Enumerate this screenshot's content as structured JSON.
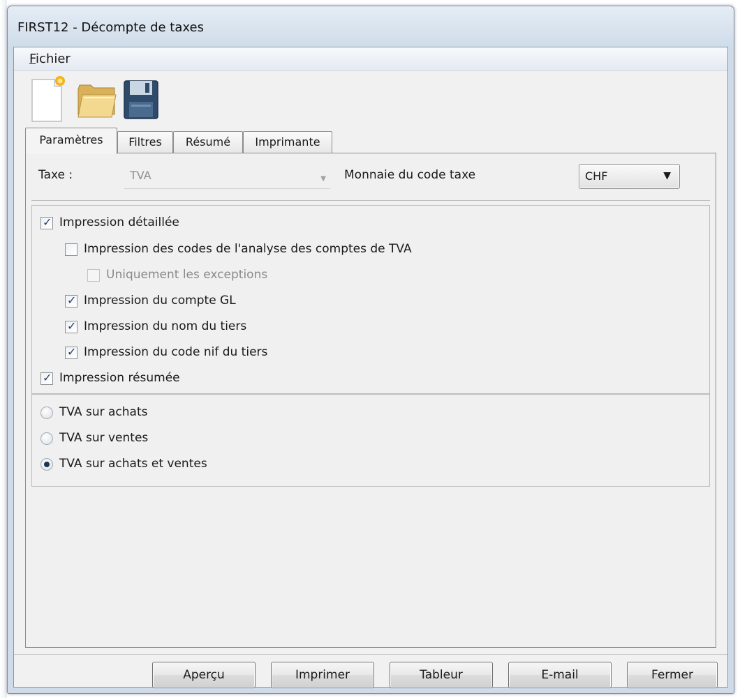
{
  "window": {
    "title": "FIRST12 - Décompte de taxes"
  },
  "menu": {
    "fichier_mnemonic": "F",
    "fichier_rest": "ichier"
  },
  "toolbar": {
    "icons": [
      "new-document-icon",
      "open-folder-icon",
      "save-floppy-icon"
    ]
  },
  "tabs": [
    {
      "label": "Paramètres",
      "active": true
    },
    {
      "label": "Filtres",
      "active": false
    },
    {
      "label": "Résumé",
      "active": false
    },
    {
      "label": "Imprimante",
      "active": false
    }
  ],
  "tax": {
    "label": "Taxe :",
    "value": "TVA",
    "currency_label": "Monnaie du code taxe",
    "currency_value": "CHF"
  },
  "options": [
    {
      "label": "Impression détaillée",
      "checked": true,
      "enabled": true
    },
    {
      "label": "Impression des codes de l'analyse des comptes de TVA",
      "checked": false,
      "enabled": true
    },
    {
      "label": "Uniquement les exceptions",
      "checked": false,
      "enabled": false
    },
    {
      "label": "Impression du compte GL",
      "checked": true,
      "enabled": true
    },
    {
      "label": "Impression du nom du tiers",
      "checked": true,
      "enabled": true
    },
    {
      "label": "Impression du code nif du tiers",
      "checked": true,
      "enabled": true
    },
    {
      "label": "Impression résumée",
      "checked": true,
      "enabled": true
    }
  ],
  "scope": [
    {
      "label": "TVA sur achats",
      "selected": false
    },
    {
      "label": "TVA sur ventes",
      "selected": false
    },
    {
      "label": "TVA sur achats et ventes",
      "selected": true
    }
  ],
  "buttons": {
    "apercu": "Aperçu",
    "imprimer": "Imprimer",
    "tableur": "Tableur",
    "email": "E-mail",
    "fermer": "Fermer"
  },
  "colors": {
    "window_frame": "#cfdbe8",
    "client_bg": "#f1f1f1",
    "check_mark": "#2c3c63"
  }
}
